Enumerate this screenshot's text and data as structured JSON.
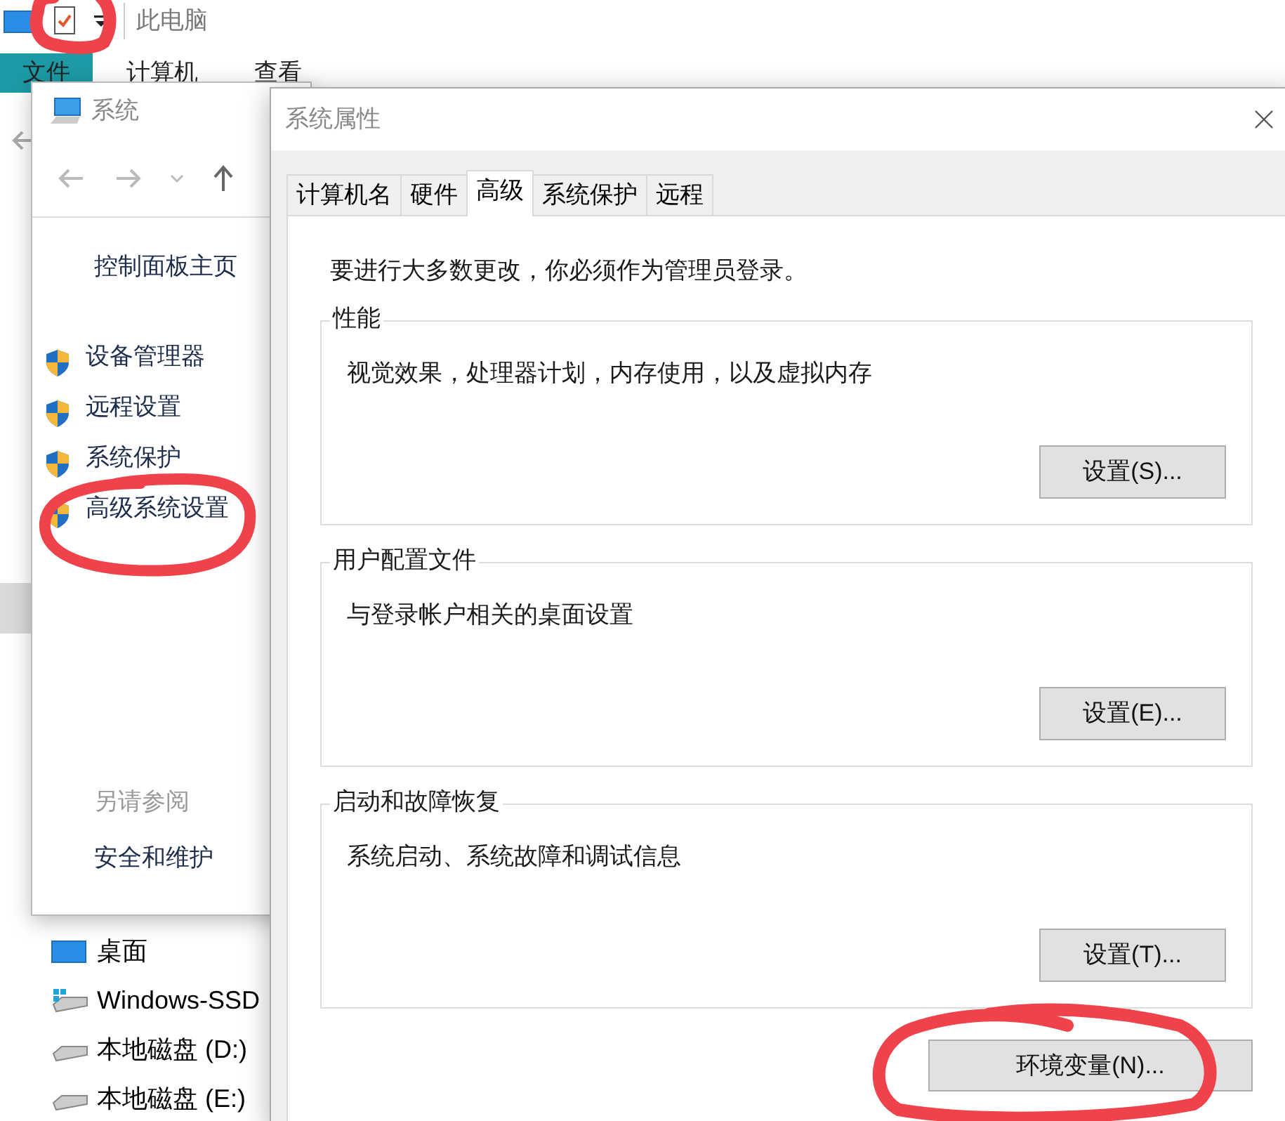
{
  "explorer": {
    "title": "此电脑",
    "ribbon_tabs": [
      {
        "label": "文件",
        "selected": true
      },
      {
        "label": "计算机",
        "selected": false
      },
      {
        "label": "查看",
        "selected": false
      }
    ],
    "nav_items": [
      {
        "label": "桌面",
        "kind": "desktop"
      },
      {
        "label": "Windows-SSD",
        "kind": "system_drive"
      },
      {
        "label": "本地磁盘 (D:)",
        "kind": "drive"
      },
      {
        "label": "本地磁盘 (E:)",
        "kind": "drive"
      }
    ]
  },
  "system_window": {
    "title": "系统",
    "home_link": "控制面板主页",
    "tasks": [
      "设备管理器",
      "远程设置",
      "系统保护",
      "高级系统设置"
    ],
    "see_also_heading": "另请参阅",
    "see_also": [
      "安全和维护"
    ]
  },
  "dialog": {
    "title": "系统属性",
    "tabs": [
      {
        "label": "计算机名",
        "selected": false
      },
      {
        "label": "硬件",
        "selected": false
      },
      {
        "label": "高级",
        "selected": true
      },
      {
        "label": "系统保护",
        "selected": false
      },
      {
        "label": "远程",
        "selected": false
      }
    ],
    "admin_note": "要进行大多数更改，你必须作为管理员登录。",
    "groups": [
      {
        "title": "性能",
        "description": "视觉效果，处理器计划，内存使用，以及虚拟内存",
        "button": "设置(S)..."
      },
      {
        "title": "用户配置文件",
        "description": "与登录帐户相关的桌面设置",
        "button": "设置(E)..."
      },
      {
        "title": "启动和故障恢复",
        "description": "系统启动、系统故障和调试信息",
        "button": "设置(T)..."
      }
    ],
    "env_button": "环境变量(N)..."
  }
}
